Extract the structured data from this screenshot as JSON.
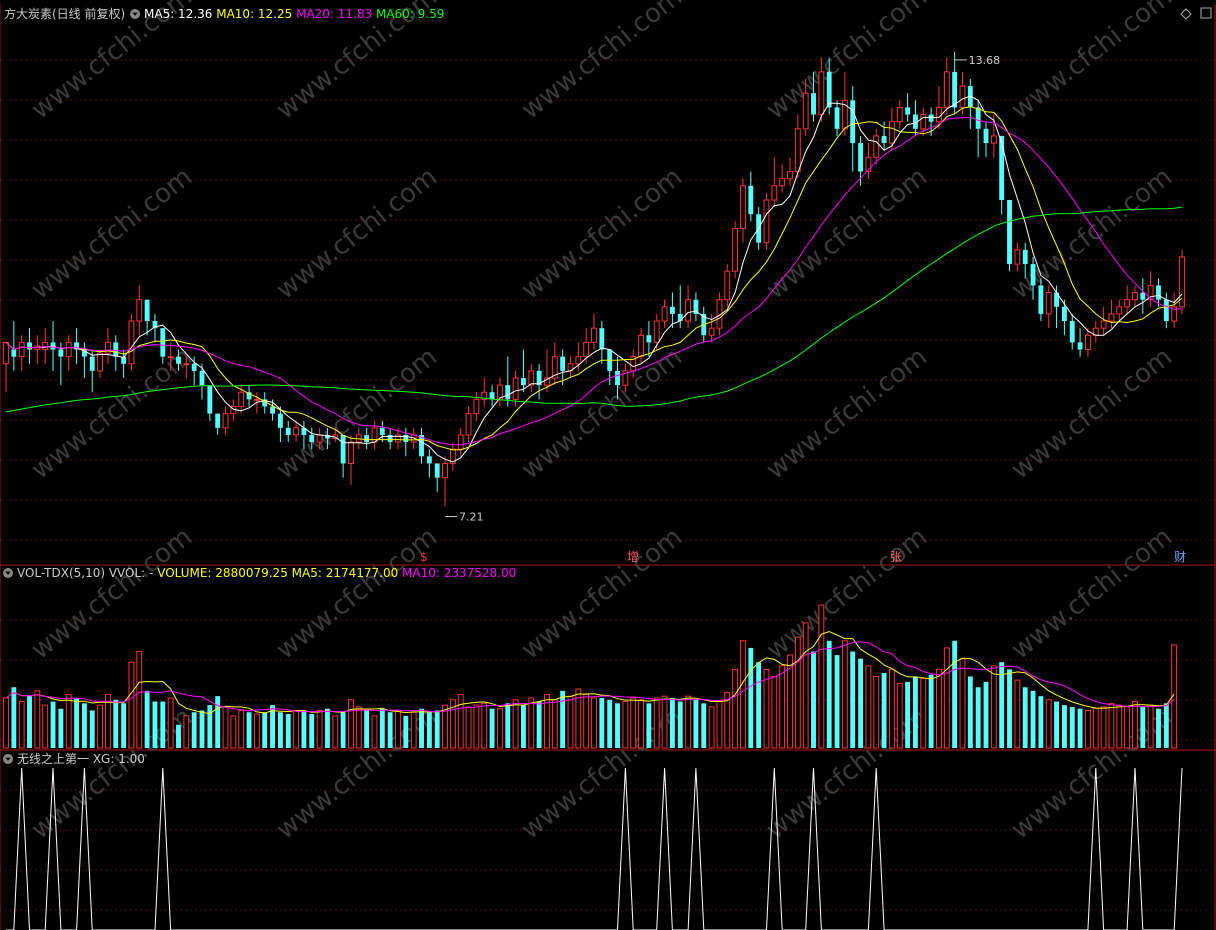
{
  "main": {
    "title": "方大炭素(日线 前复权)",
    "ma_legend": [
      {
        "label": "MA5: 12.36",
        "color": "#ffffff"
      },
      {
        "label": "MA10: 12.25",
        "color": "#ffff00"
      },
      {
        "label": "MA20: 11.83",
        "color": "#ff00ff"
      },
      {
        "label": "MA60: 9.59",
        "color": "#00ff00"
      }
    ],
    "high_label": "13.68",
    "low_label": "7.21",
    "event_markers": [
      "$",
      "增",
      "张",
      "财"
    ],
    "watermark": "www.cfchi.com"
  },
  "volume": {
    "legend": [
      {
        "label": "VOL-TDX(5,10)",
        "color": "#cccccc"
      },
      {
        "label": "VVOL: -",
        "color": "#cccccc"
      },
      {
        "label": "VOLUME: 2880079.25",
        "color": "#ffff00"
      },
      {
        "label": "MA5: 2174177.00",
        "color": "#ffff00"
      },
      {
        "label": "MA10: 2337528.00",
        "color": "#ff00ff"
      }
    ]
  },
  "indicator": {
    "legend": [
      {
        "label": "无线之上第一",
        "color": "#cccccc"
      },
      {
        "label": "XG: 1.00",
        "color": "#cccccc"
      }
    ]
  },
  "chart_data": [
    {
      "type": "candlestick",
      "title": "方大炭素(日线 前复权)",
      "ylim": [
        6.6,
        14.1
      ],
      "high_marker": 13.68,
      "low_marker": 7.21,
      "bars": [
        [
          9.3,
          9.6,
          9.5,
          8.9
        ],
        [
          9.5,
          9.4,
          9.9,
          9.2
        ],
        [
          9.4,
          9.6,
          9.7,
          9.2
        ],
        [
          9.6,
          9.5,
          9.8,
          9.3
        ],
        [
          9.5,
          9.55,
          9.7,
          9.3
        ],
        [
          9.5,
          9.6,
          9.8,
          9.3
        ],
        [
          9.6,
          9.5,
          9.9,
          9.2
        ],
        [
          9.5,
          9.4,
          9.6,
          9.0
        ],
        [
          9.4,
          9.6,
          9.7,
          9.2
        ],
        [
          9.6,
          9.5,
          9.8,
          9.3
        ],
        [
          9.5,
          9.4,
          9.6,
          9.1
        ],
        [
          9.4,
          9.2,
          9.5,
          8.9
        ],
        [
          9.2,
          9.45,
          9.5,
          9.1
        ],
        [
          9.45,
          9.6,
          9.8,
          9.3
        ],
        [
          9.6,
          9.4,
          9.7,
          9.2
        ],
        [
          9.4,
          9.3,
          9.5,
          9.1
        ],
        [
          9.3,
          9.9,
          10.0,
          9.2
        ],
        [
          9.9,
          10.2,
          10.4,
          9.7
        ],
        [
          10.2,
          9.9,
          10.2,
          9.7
        ],
        [
          9.9,
          9.8,
          10.0,
          9.6
        ],
        [
          9.8,
          9.4,
          9.8,
          9.3
        ],
        [
          9.4,
          9.4,
          9.6,
          9.2
        ],
        [
          9.4,
          9.3,
          9.5,
          9.2
        ],
        [
          9.3,
          9.3,
          9.4,
          9.1
        ],
        [
          9.3,
          9.2,
          9.4,
          9.0
        ],
        [
          9.2,
          9.0,
          9.3,
          8.8
        ],
        [
          9.0,
          8.6,
          9.0,
          8.5
        ],
        [
          8.6,
          8.4,
          8.6,
          8.3
        ],
        [
          8.4,
          8.6,
          8.7,
          8.3
        ],
        [
          8.6,
          8.7,
          8.8,
          8.5
        ],
        [
          8.7,
          8.9,
          9.0,
          8.6
        ],
        [
          8.9,
          8.8,
          9.0,
          8.7
        ],
        [
          8.8,
          8.8,
          8.9,
          8.6
        ],
        [
          8.8,
          8.7,
          8.9,
          8.6
        ],
        [
          8.7,
          8.6,
          8.8,
          8.5
        ],
        [
          8.6,
          8.4,
          8.7,
          8.2
        ],
        [
          8.4,
          8.3,
          8.5,
          8.2
        ],
        [
          8.3,
          8.4,
          8.5,
          8.2
        ],
        [
          8.4,
          8.3,
          8.5,
          8.1
        ],
        [
          8.3,
          8.2,
          8.4,
          8.1
        ],
        [
          8.2,
          8.3,
          8.4,
          8.1
        ],
        [
          8.3,
          8.25,
          8.4,
          8.1
        ],
        [
          8.25,
          8.3,
          8.4,
          8.2
        ],
        [
          8.3,
          7.9,
          8.3,
          7.7
        ],
        [
          7.9,
          8.2,
          8.3,
          7.6
        ],
        [
          8.2,
          8.3,
          8.4,
          8.1
        ],
        [
          8.3,
          8.2,
          8.4,
          8.1
        ],
        [
          8.2,
          8.4,
          8.5,
          8.1
        ],
        [
          8.4,
          8.3,
          8.5,
          8.2
        ],
        [
          8.3,
          8.2,
          8.4,
          8.1
        ],
        [
          8.2,
          8.3,
          8.4,
          8.1
        ],
        [
          8.3,
          8.2,
          8.4,
          8.0
        ],
        [
          8.2,
          8.3,
          8.4,
          8.1
        ],
        [
          8.3,
          8.0,
          8.4,
          7.9
        ],
        [
          8.0,
          7.9,
          8.1,
          7.7
        ],
        [
          7.9,
          7.7,
          7.9,
          7.5
        ],
        [
          7.7,
          7.9,
          8.0,
          7.3
        ],
        [
          7.9,
          8.1,
          8.2,
          7.8
        ],
        [
          8.1,
          8.3,
          8.4,
          8.0
        ],
        [
          8.3,
          8.6,
          8.7,
          8.2
        ],
        [
          8.6,
          8.8,
          8.9,
          8.5
        ],
        [
          8.8,
          8.9,
          9.1,
          8.7
        ],
        [
          8.9,
          8.8,
          9.0,
          8.7
        ],
        [
          8.8,
          9.0,
          9.1,
          8.7
        ],
        [
          9.0,
          8.8,
          9.4,
          8.7
        ],
        [
          8.8,
          9.1,
          9.2,
          8.7
        ],
        [
          9.1,
          9.0,
          9.5,
          8.9
        ],
        [
          9.0,
          9.2,
          9.3,
          8.9
        ],
        [
          9.2,
          9.0,
          9.3,
          8.8
        ],
        [
          9.0,
          9.1,
          9.5,
          8.9
        ],
        [
          9.1,
          9.4,
          9.6,
          9.0
        ],
        [
          9.4,
          9.2,
          9.5,
          9.0
        ],
        [
          9.2,
          9.3,
          9.4,
          9.1
        ],
        [
          9.3,
          9.4,
          9.6,
          9.2
        ],
        [
          9.4,
          9.6,
          9.8,
          9.3
        ],
        [
          9.6,
          9.8,
          10.0,
          9.5
        ],
        [
          9.8,
          9.5,
          9.9,
          9.3
        ],
        [
          9.5,
          9.2,
          9.5,
          9.0
        ],
        [
          9.2,
          9.0,
          9.4,
          8.8
        ],
        [
          9.0,
          9.2,
          9.3,
          8.9
        ],
        [
          9.2,
          9.4,
          9.5,
          9.1
        ],
        [
          9.4,
          9.7,
          9.8,
          9.3
        ],
        [
          9.7,
          9.6,
          9.9,
          9.4
        ],
        [
          9.6,
          9.9,
          10.0,
          9.5
        ],
        [
          9.9,
          10.1,
          10.2,
          9.8
        ],
        [
          10.1,
          10.0,
          10.3,
          9.8
        ],
        [
          10.0,
          9.9,
          10.4,
          9.8
        ],
        [
          9.9,
          10.2,
          10.4,
          9.8
        ],
        [
          10.2,
          10.0,
          10.3,
          9.9
        ],
        [
          10.0,
          9.7,
          10.1,
          9.6
        ],
        [
          9.7,
          9.8,
          10.0,
          9.6
        ],
        [
          9.8,
          10.2,
          10.3,
          9.7
        ],
        [
          10.2,
          10.6,
          10.7,
          10.1
        ],
        [
          10.6,
          11.2,
          11.3,
          10.5
        ],
        [
          11.2,
          11.8,
          11.9,
          11.0
        ],
        [
          11.8,
          11.4,
          12.0,
          11.3
        ],
        [
          11.4,
          11.0,
          11.5,
          10.9
        ],
        [
          11.0,
          11.6,
          11.7,
          10.9
        ],
        [
          11.6,
          11.8,
          12.2,
          11.5
        ],
        [
          11.8,
          11.9,
          12.1,
          11.7
        ],
        [
          11.9,
          12.0,
          12.2,
          11.8
        ],
        [
          12.0,
          12.6,
          12.8,
          11.9
        ],
        [
          12.6,
          13.1,
          13.3,
          12.5
        ],
        [
          13.1,
          12.8,
          13.4,
          12.7
        ],
        [
          12.8,
          13.4,
          13.6,
          12.7
        ],
        [
          13.4,
          12.9,
          13.6,
          12.8
        ],
        [
          12.9,
          12.6,
          13.0,
          12.5
        ],
        [
          12.6,
          13.0,
          13.4,
          12.5
        ],
        [
          13.0,
          12.4,
          13.2,
          12.0
        ],
        [
          12.4,
          12.0,
          12.5,
          11.8
        ],
        [
          12.0,
          12.2,
          12.4,
          11.9
        ],
        [
          12.2,
          12.5,
          12.6,
          12.1
        ],
        [
          12.5,
          12.4,
          12.7,
          12.3
        ],
        [
          12.4,
          12.7,
          12.9,
          12.3
        ],
        [
          12.7,
          12.9,
          13.0,
          12.6
        ],
        [
          12.9,
          12.8,
          13.1,
          12.7
        ],
        [
          12.8,
          12.6,
          13.0,
          12.5
        ],
        [
          12.6,
          12.8,
          12.9,
          12.5
        ],
        [
          12.8,
          12.7,
          12.9,
          12.5
        ],
        [
          12.7,
          12.9,
          13.2,
          12.6
        ],
        [
          12.9,
          13.4,
          13.6,
          12.8
        ],
        [
          13.4,
          12.9,
          13.68,
          12.8
        ],
        [
          12.9,
          13.2,
          13.4,
          12.8
        ],
        [
          13.2,
          12.9,
          13.3,
          12.6
        ],
        [
          12.9,
          12.6,
          13.0,
          12.2
        ],
        [
          12.6,
          12.4,
          12.7,
          12.2
        ],
        [
          12.4,
          12.5,
          12.8,
          12.2
        ],
        [
          12.5,
          11.6,
          12.5,
          11.4
        ],
        [
          11.6,
          10.7,
          11.6,
          10.6
        ],
        [
          10.7,
          10.9,
          11.0,
          10.6
        ],
        [
          10.9,
          10.7,
          11.0,
          10.5
        ],
        [
          10.7,
          10.4,
          10.8,
          10.2
        ],
        [
          10.4,
          10.0,
          10.5,
          9.9
        ],
        [
          10.0,
          10.3,
          10.4,
          9.8
        ],
        [
          10.3,
          10.1,
          10.4,
          9.8
        ],
        [
          10.1,
          9.9,
          10.2,
          9.7
        ],
        [
          9.9,
          9.6,
          10.0,
          9.5
        ],
        [
          9.6,
          9.5,
          9.8,
          9.4
        ],
        [
          9.5,
          9.7,
          9.8,
          9.4
        ],
        [
          9.7,
          9.8,
          9.9,
          9.6
        ],
        [
          9.8,
          9.9,
          10.1,
          9.7
        ],
        [
          9.9,
          10.0,
          10.2,
          9.8
        ],
        [
          10.0,
          10.1,
          10.2,
          9.9
        ],
        [
          10.1,
          10.2,
          10.4,
          10.0
        ],
        [
          10.2,
          10.3,
          10.4,
          10.1
        ],
        [
          10.3,
          10.2,
          10.5,
          10.0
        ],
        [
          10.2,
          10.4,
          10.6,
          10.1
        ],
        [
          10.4,
          10.2,
          10.5,
          10.1
        ],
        [
          10.2,
          9.9,
          10.3,
          9.8
        ],
        [
          9.9,
          10.1,
          10.3,
          9.8
        ],
        [
          10.1,
          10.8,
          10.9,
          10.0
        ]
      ]
    },
    {
      "type": "bar",
      "title": "VOL-TDX(5,10)",
      "ylim": [
        0,
        4700000
      ],
      "values": [
        1400000,
        1700000,
        1300000,
        1450000,
        1600000,
        1200000,
        1300000,
        1100000,
        1500000,
        1400000,
        1250000,
        1050000,
        1200000,
        1500000,
        1350000,
        1250000,
        2400000,
        2700000,
        1600000,
        1300000,
        1300000,
        1400000,
        650000,
        900000,
        1000000,
        1050000,
        1200000,
        1450000,
        1150000,
        900000,
        1050000,
        1000000,
        950000,
        1000000,
        1200000,
        1000000,
        950000,
        1050000,
        1050000,
        950000,
        1050000,
        1100000,
        900000,
        1000000,
        1350000,
        1150000,
        1050000,
        900000,
        1100000,
        1000000,
        1050000,
        900000,
        1000000,
        1100000,
        1000000,
        1050000,
        1200000,
        1350000,
        1500000,
        1150000,
        1200000,
        1250000,
        1100000,
        1100000,
        1250000,
        1350000,
        1200000,
        1400000,
        1300000,
        1500000,
        1350000,
        1600000,
        1450000,
        1650000,
        1500000,
        1400000,
        1400000,
        1350000,
        1250000,
        1300000,
        1400000,
        1350000,
        1250000,
        1400000,
        1450000,
        1400000,
        1300000,
        1450000,
        1350000,
        1250000,
        1150000,
        1300000,
        1550000,
        2200000,
        3000000,
        2800000,
        2400000,
        2200000,
        2000000,
        2300000,
        2600000,
        3100000,
        3500000,
        2700000,
        4000000,
        3000000,
        2600000,
        3000000,
        2700000,
        2500000,
        2300000,
        2000000,
        2100000,
        2200000,
        1800000,
        1850000,
        2000000,
        1950000,
        2050000,
        2200000,
        2800000,
        3000000,
        2500000,
        2000000,
        1700000,
        1850000,
        2300000,
        2400000,
        2200000,
        1900000,
        1700000,
        1600000,
        1450000,
        1350000,
        1300000,
        1200000,
        1150000,
        1100000,
        1050000,
        1100000,
        1150000,
        1250000,
        1200000,
        1150000,
        1300000,
        1150000,
        1200000,
        1100000,
        1250000,
        2880079
      ]
    },
    {
      "type": "line",
      "title": "无线之上第一",
      "ylim": [
        0,
        1
      ],
      "series": [
        {
          "name": "XG",
          "spike_indices": [
            2,
            6,
            10,
            20,
            79,
            84,
            88,
            98,
            103,
            111,
            139,
            144
          ],
          "last_value": 1.0
        }
      ]
    }
  ]
}
